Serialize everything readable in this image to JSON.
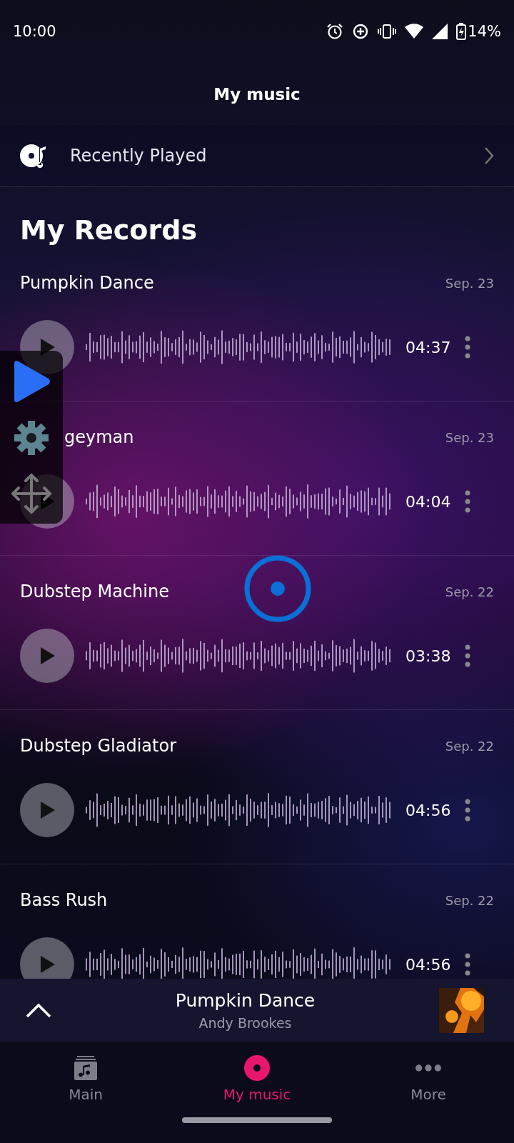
{
  "status_bar": {
    "time": "10:00",
    "battery": "14%"
  },
  "header": {
    "title": "My music"
  },
  "recently_played": {
    "label": "Recently Played"
  },
  "section_title": "My Records",
  "records": [
    {
      "title": "Pumpkin Dance",
      "date": "Sep. 23",
      "duration": "04:37",
      "covered": false
    },
    {
      "title": "geyman",
      "date": "Sep. 23",
      "duration": "04:04",
      "covered": true
    },
    {
      "title": "Dubstep Machine",
      "date": "Sep. 22",
      "duration": "03:38",
      "covered": false
    },
    {
      "title": "Dubstep Gladiator",
      "date": "Sep. 22",
      "duration": "04:56",
      "covered": false
    },
    {
      "title": "Bass Rush",
      "date": "Sep. 22",
      "duration": "04:56",
      "covered": false
    }
  ],
  "mini_player": {
    "title": "Pumpkin Dance",
    "artist": "Andy Brookes"
  },
  "nav": [
    {
      "kind": "library",
      "label": "Main",
      "selected": false
    },
    {
      "kind": "disc",
      "label": "My music",
      "selected": true
    },
    {
      "kind": "more",
      "label": "More",
      "selected": false
    }
  ]
}
